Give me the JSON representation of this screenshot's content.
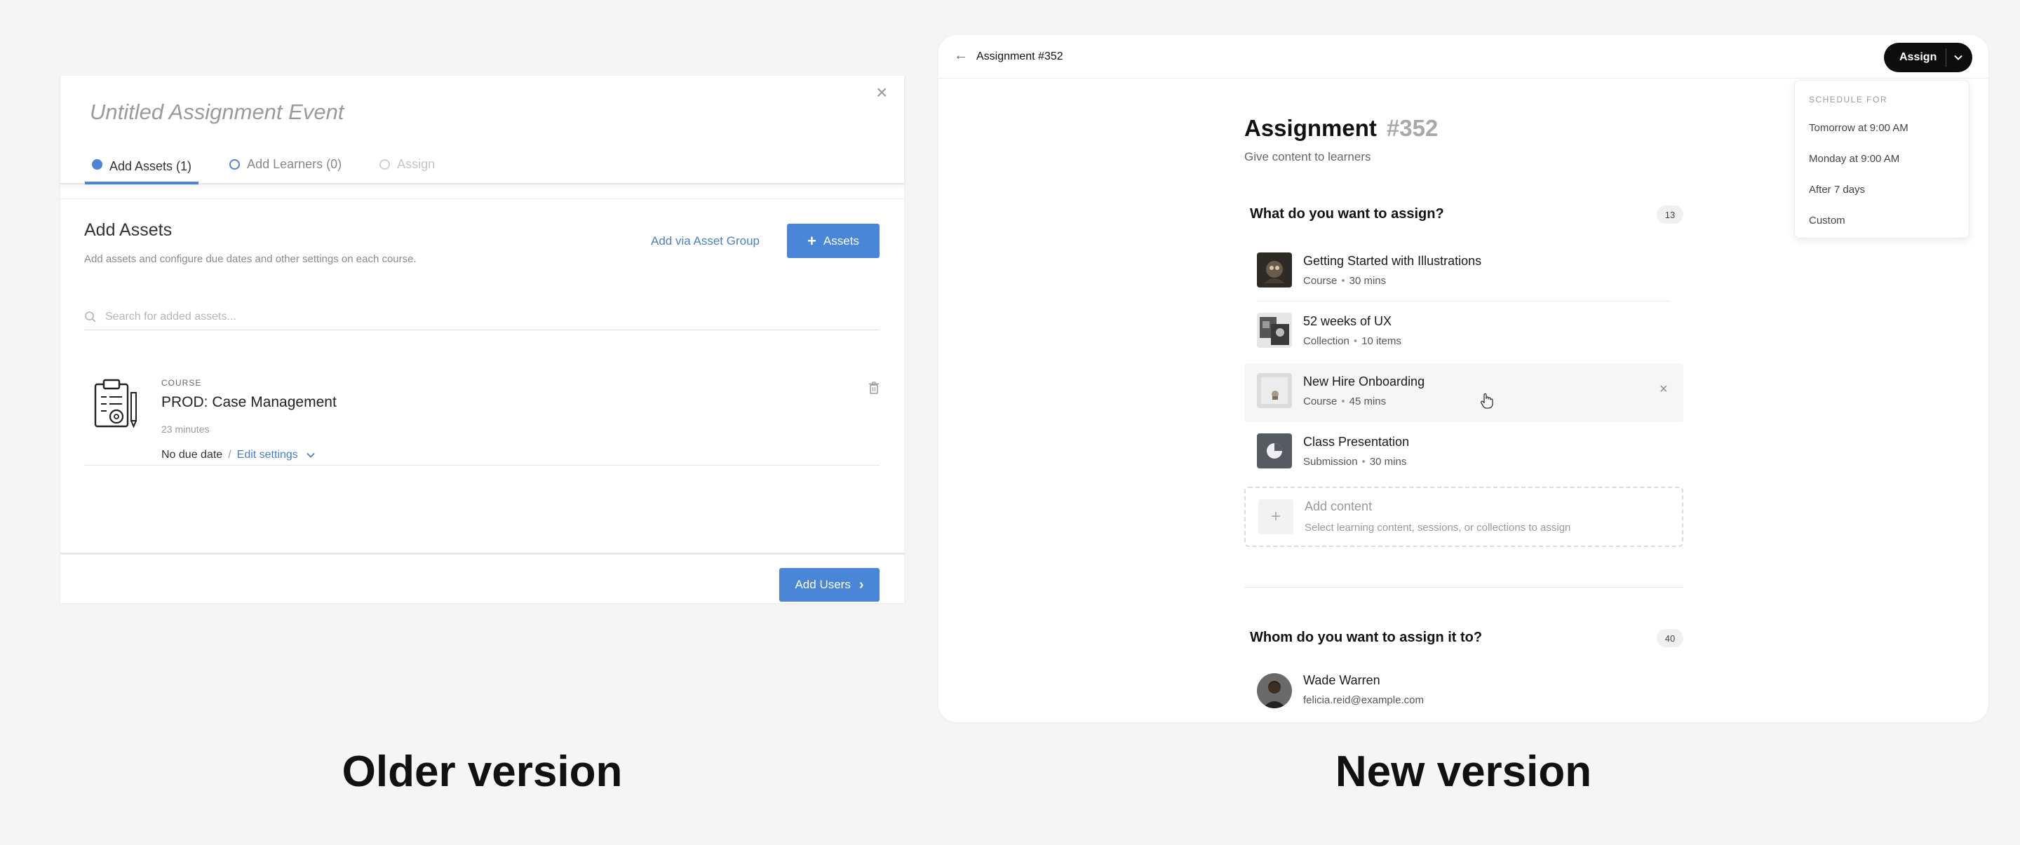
{
  "old": {
    "title": "Untitled Assignment Event",
    "tabs": [
      {
        "label": "Add Assets (1)"
      },
      {
        "label": "Add Learners (0)"
      },
      {
        "label": "Assign"
      }
    ],
    "heading": "Add Assets",
    "subheading": "Add assets and configure due dates and other settings on each course.",
    "add_group_link": "Add via Asset Group",
    "assets_button": "Assets",
    "search_placeholder": "Search for added assets...",
    "item": {
      "kind": "COURSE",
      "name": "PROD: Case Management",
      "duration": "23 minutes",
      "due": "No due date",
      "separator": "/",
      "edit": "Edit settings"
    },
    "add_users_button": "Add Users",
    "caption": "Older version"
  },
  "new": {
    "breadcrumb": "Assignment #352",
    "assign_button": "Assign",
    "schedule": {
      "header": "SCHEDULE FOR",
      "options": [
        "Tomorrow at 9:00 AM",
        "Monday at 9:00 AM",
        "After 7 days",
        "Custom"
      ]
    },
    "heading": "Assignment",
    "heading_number": "#352",
    "subheading": "Give content to learners",
    "content_section": {
      "title": "What do you want to assign?",
      "count": "13",
      "items": [
        {
          "title": "Getting Started with Illustrations",
          "type": "Course",
          "detail": "30 mins"
        },
        {
          "title": "52 weeks of UX",
          "type": "Collection",
          "detail": "10 items"
        },
        {
          "title": "New Hire Onboarding",
          "type": "Course",
          "detail": "45 mins"
        },
        {
          "title": "Class Presentation",
          "type": "Submission",
          "detail": "30 mins"
        }
      ],
      "add_title": "Add content",
      "add_desc": "Select learning content, sessions, or collections to assign"
    },
    "learner_section": {
      "title": "Whom do you want to assign it to?",
      "count": "40",
      "user": {
        "name": "Wade Warren",
        "email": "felicia.reid@example.com"
      }
    },
    "caption": "New version"
  },
  "colors": {
    "old_accent": "#4a86d8",
    "new_primary": "#0d0d0d"
  }
}
